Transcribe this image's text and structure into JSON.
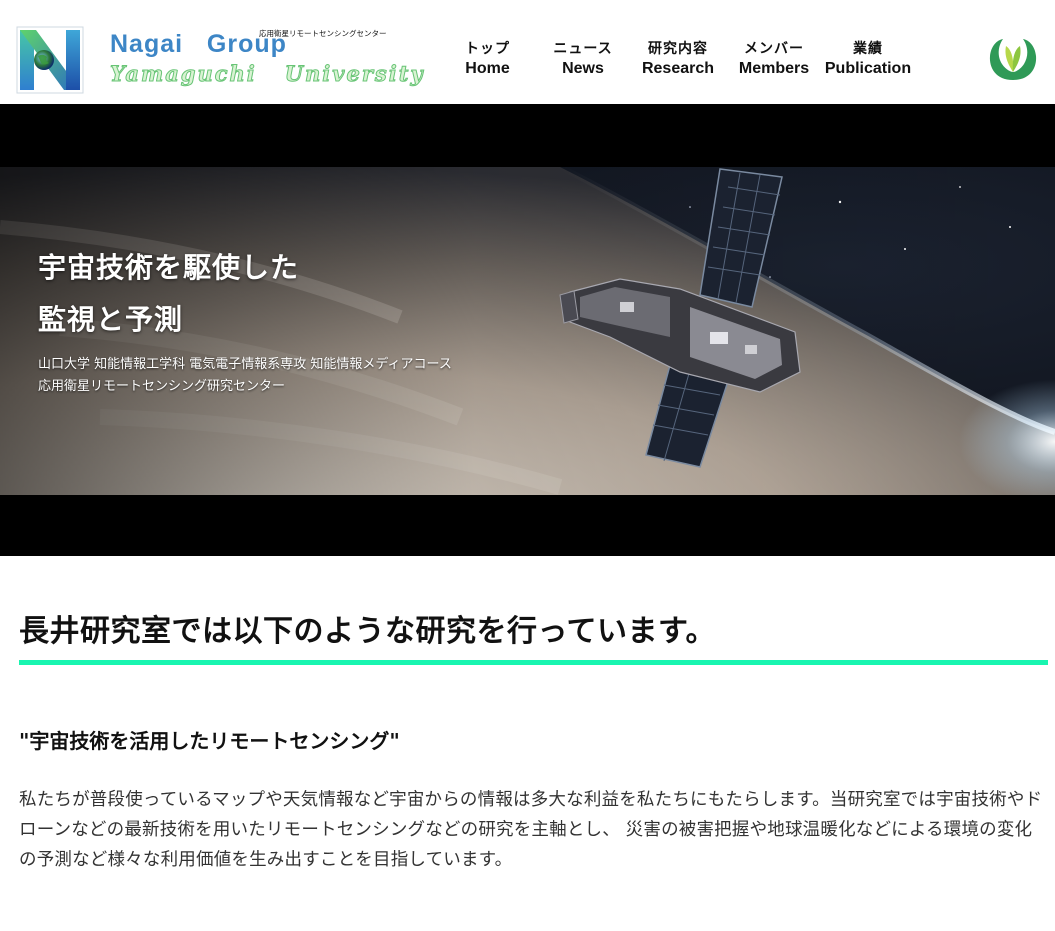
{
  "header": {
    "brand_name": "Nagai   Group",
    "brand_sub": "応用衛星リモートセンシングセンター",
    "brand_univ": "Yamaguchi   University",
    "logo_letter": "N",
    "logo_icon": "nagai-group-logo",
    "emblem_icon": "yamaguchi-university-emblem"
  },
  "nav": {
    "items": [
      {
        "ja": "トップ",
        "en": "Home"
      },
      {
        "ja": "ニュース",
        "en": "News"
      },
      {
        "ja": "研究内容",
        "en": "Research"
      },
      {
        "ja": "メンバー",
        "en": "Members"
      },
      {
        "ja": "業績",
        "en": "Publication"
      }
    ]
  },
  "hero": {
    "title_line1": "宇宙技術を駆使した",
    "title_line2": "監視と予測",
    "sub_line1": "山口大学 知能情報工学科 電気電子情報系専攻 知能情報メディアコース",
    "sub_line2": "応用衛星リモートセンシング研究センター",
    "image_icon": "satellite-over-earth-image"
  },
  "main": {
    "heading": "長井研究室では以下のような研究を行っています。",
    "topic_title": "\"宇宙技術を活用したリモートセンシング\"",
    "topic_body": "私たちが普段使っているマップや天気情報など宇宙からの情報は多大な利益を私たちにもたらします。当研究室では宇宙技術やドローンなどの最新技術を用いたリモートセンシングなどの研究を主軸とし、 災害の被害把握や地球温暖化などによる環境の変化の予測など様々な利用価値を生み出すことを目指しています。"
  },
  "colors": {
    "accent_rule": "#19f5b0",
    "brand_blue": "#3d86c6",
    "brand_green": "#68c476",
    "text": "#222222"
  }
}
